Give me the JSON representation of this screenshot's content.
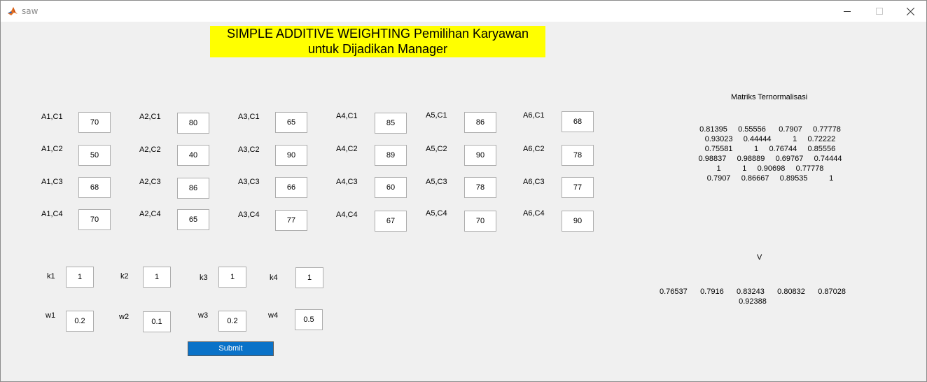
{
  "window": {
    "title": "saw"
  },
  "heading": {
    "line1": "SIMPLE ADDITIVE WEIGHTING Pemilihan Karyawan",
    "line2": "untuk Dijadikan Manager"
  },
  "alternatives": {
    "labels": [
      [
        "A1,C1",
        "A1,C2",
        "A1,C3",
        "A1,C4"
      ],
      [
        "A2,C1",
        "A2,C2",
        "A2,C3",
        "A2,C4"
      ],
      [
        "A3,C1",
        "A3,C2",
        "A3,C3",
        "A3,C4"
      ],
      [
        "A4,C1",
        "A4,C2",
        "A4,C3",
        "A4,C4"
      ],
      [
        "A5,C1",
        "A5,C2",
        "A5,C3",
        "A5,C4"
      ],
      [
        "A6,C1",
        "A6,C2",
        "A6,C3",
        "A6,C4"
      ]
    ],
    "values": [
      [
        "70",
        "50",
        "68",
        "70"
      ],
      [
        "80",
        "40",
        "86",
        "65"
      ],
      [
        "65",
        "90",
        "66",
        "77"
      ],
      [
        "85",
        "89",
        "60",
        "67"
      ],
      [
        "86",
        "90",
        "78",
        "70"
      ],
      [
        "68",
        "78",
        "77",
        "90"
      ]
    ]
  },
  "criteria_type": {
    "labels": [
      "k1",
      "k2",
      "k3",
      "k4"
    ],
    "values": [
      "1",
      "1",
      "1",
      "1"
    ]
  },
  "weights": {
    "labels": [
      "w1",
      "w2",
      "w3",
      "w4"
    ],
    "values": [
      "0.2",
      "0.1",
      "0.2",
      "0.5"
    ]
  },
  "submit_label": "Submit",
  "normalized": {
    "title": "Matriks Ternormalisasi",
    "rows": [
      "0.81395     0.55556      0.7907     0.77778",
      "0.93023     0.44444          1     0.72222",
      "0.75581          1     0.76744     0.85556",
      "0.98837     0.98889     0.69767     0.74444",
      "1          1     0.90698     0.77778",
      "0.7907     0.86667     0.89535          1"
    ]
  },
  "result": {
    "title": "V",
    "line1": "0.76537      0.7916      0.83243      0.80832      0.87028",
    "line2": "0.92388"
  }
}
